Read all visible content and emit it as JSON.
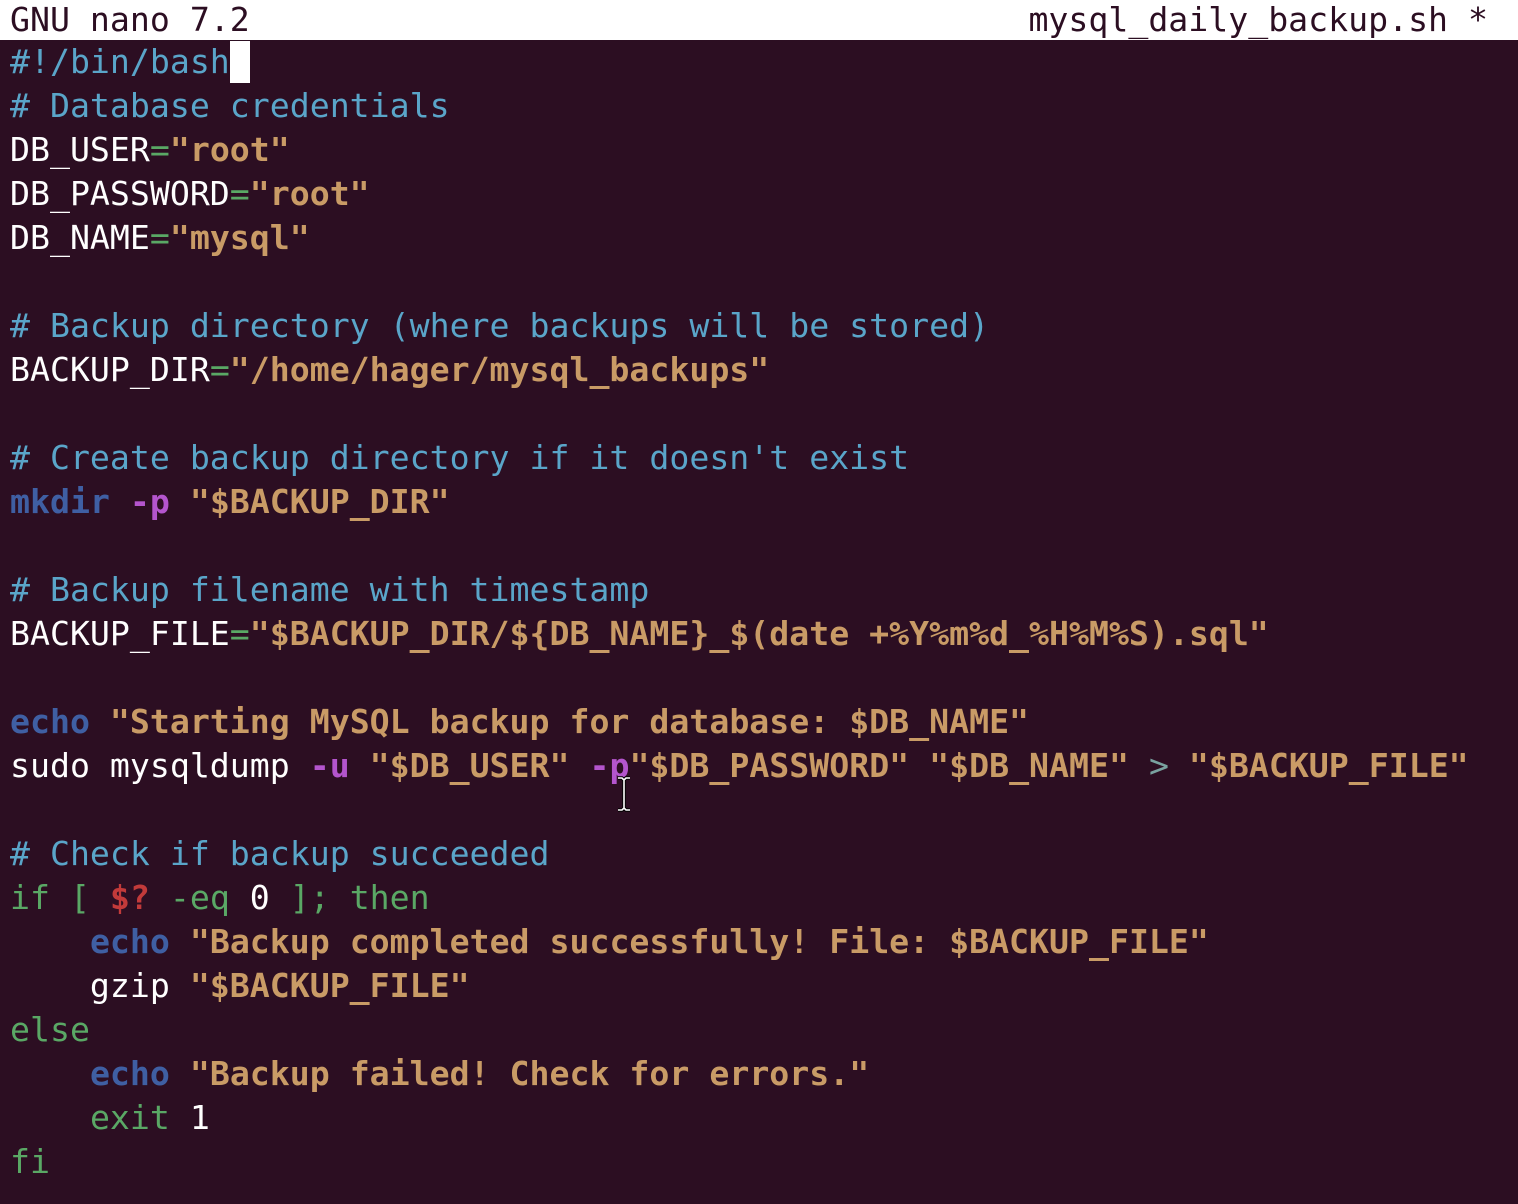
{
  "header": {
    "app_name": "GNU nano 7.2",
    "file_title": "mysql_daily_backup.sh *"
  },
  "colors": {
    "background": "#2c0e22",
    "header_bg": "#ffffff",
    "header_fg": "#2c0e22",
    "default_text": "#ffffff",
    "comment": "#5aa5c9",
    "string": "#c99b66",
    "builtin": "#3f5fa3",
    "option": "#b455cd",
    "keyword": "#5aa865",
    "special_var": "#c23a3a",
    "operator": "#7aa2a0"
  },
  "editor": {
    "lines": [
      {
        "tokens": [
          {
            "t": "#!/bin/bash",
            "c": "comment"
          }
        ],
        "cursor": true
      },
      {
        "tokens": [
          {
            "t": "# Database credentials",
            "c": "comment"
          }
        ]
      },
      {
        "tokens": [
          {
            "t": "DB_USER",
            "c": "default"
          },
          {
            "t": "=",
            "c": "keyword"
          },
          {
            "t": "\"root\"",
            "c": "string"
          }
        ]
      },
      {
        "tokens": [
          {
            "t": "DB_PASSWORD",
            "c": "default"
          },
          {
            "t": "=",
            "c": "keyword"
          },
          {
            "t": "\"root\"",
            "c": "string"
          }
        ]
      },
      {
        "tokens": [
          {
            "t": "DB_NAME",
            "c": "default"
          },
          {
            "t": "=",
            "c": "keyword"
          },
          {
            "t": "\"mysql\"",
            "c": "string"
          }
        ]
      },
      {
        "tokens": []
      },
      {
        "tokens": [
          {
            "t": "# Backup directory (where backups will be stored)",
            "c": "comment"
          }
        ]
      },
      {
        "tokens": [
          {
            "t": "BACKUP_DIR",
            "c": "default"
          },
          {
            "t": "=",
            "c": "keyword"
          },
          {
            "t": "\"/home/hager/mysql_backups\"",
            "c": "string"
          }
        ]
      },
      {
        "tokens": []
      },
      {
        "tokens": [
          {
            "t": "# Create backup directory if it doesn't exist",
            "c": "comment"
          }
        ]
      },
      {
        "tokens": [
          {
            "t": "mkdir",
            "c": "builtin"
          },
          {
            "t": " ",
            "c": "default"
          },
          {
            "t": "-p",
            "c": "option"
          },
          {
            "t": " ",
            "c": "default"
          },
          {
            "t": "\"$BACKUP_DIR\"",
            "c": "string"
          }
        ]
      },
      {
        "tokens": []
      },
      {
        "tokens": [
          {
            "t": "# Backup filename with timestamp",
            "c": "comment"
          }
        ]
      },
      {
        "tokens": [
          {
            "t": "BACKUP_FILE",
            "c": "default"
          },
          {
            "t": "=",
            "c": "keyword"
          },
          {
            "t": "\"$BACKUP_DIR/${DB_NAME}_$(date +%Y%m%d_%H%M%S).sql\"",
            "c": "string"
          }
        ]
      },
      {
        "tokens": []
      },
      {
        "tokens": [
          {
            "t": "echo",
            "c": "builtin"
          },
          {
            "t": " ",
            "c": "default"
          },
          {
            "t": "\"Starting MySQL backup for database: $DB_NAME\"",
            "c": "string"
          }
        ]
      },
      {
        "tokens": [
          {
            "t": "sudo mysqldump ",
            "c": "default"
          },
          {
            "t": "-u",
            "c": "option"
          },
          {
            "t": " ",
            "c": "default"
          },
          {
            "t": "\"$DB_USER\"",
            "c": "string"
          },
          {
            "t": " ",
            "c": "default"
          },
          {
            "t": "-p",
            "c": "option"
          },
          {
            "t": "\"$DB_PASSWORD\"",
            "c": "string"
          },
          {
            "t": " ",
            "c": "default"
          },
          {
            "t": "\"$DB_NAME\"",
            "c": "string"
          },
          {
            "t": " > ",
            "c": "operator"
          },
          {
            "t": "\"$BACKUP_FILE\"",
            "c": "string"
          }
        ]
      },
      {
        "tokens": []
      },
      {
        "tokens": [
          {
            "t": "# Check if backup succeeded",
            "c": "comment"
          }
        ]
      },
      {
        "tokens": [
          {
            "t": "if [ ",
            "c": "keyword"
          },
          {
            "t": "$?",
            "c": "special_var"
          },
          {
            "t": " -eq ",
            "c": "keyword"
          },
          {
            "t": "0",
            "c": "default"
          },
          {
            "t": " ]; then",
            "c": "keyword"
          }
        ]
      },
      {
        "tokens": [
          {
            "t": "    ",
            "c": "default"
          },
          {
            "t": "echo",
            "c": "builtin"
          },
          {
            "t": " ",
            "c": "default"
          },
          {
            "t": "\"Backup completed successfully! File: $BACKUP_FILE\"",
            "c": "string"
          }
        ]
      },
      {
        "tokens": [
          {
            "t": "    gzip ",
            "c": "default"
          },
          {
            "t": "\"$BACKUP_FILE\"",
            "c": "string"
          }
        ]
      },
      {
        "tokens": [
          {
            "t": "else",
            "c": "keyword"
          }
        ]
      },
      {
        "tokens": [
          {
            "t": "    ",
            "c": "default"
          },
          {
            "t": "echo",
            "c": "builtin"
          },
          {
            "t": " ",
            "c": "default"
          },
          {
            "t": "\"Backup failed! Check for errors.\"",
            "c": "string"
          }
        ]
      },
      {
        "tokens": [
          {
            "t": "    ",
            "c": "default"
          },
          {
            "t": "exit",
            "c": "keyword"
          },
          {
            "t": " ",
            "c": "default"
          },
          {
            "t": "1",
            "c": "default"
          }
        ]
      },
      {
        "tokens": [
          {
            "t": "fi",
            "c": "keyword"
          }
        ]
      }
    ]
  },
  "mouse_cursor_icon": "i-beam-cursor-icon"
}
